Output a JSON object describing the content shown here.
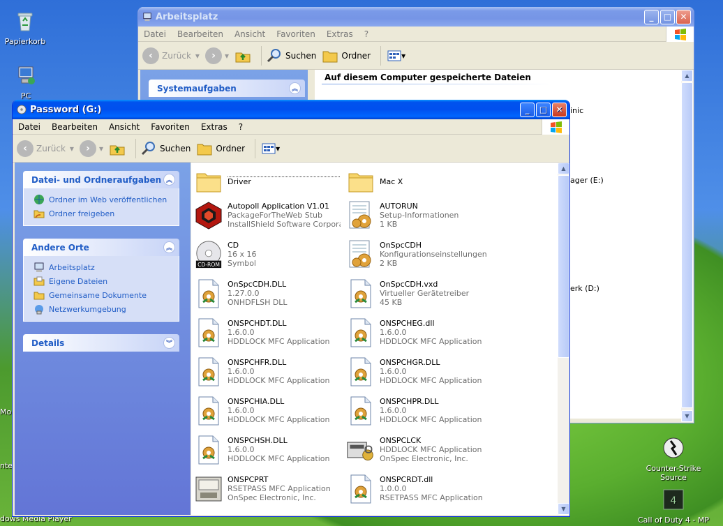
{
  "desktop": {
    "icons": [
      {
        "label": "Papierkorb",
        "icon": "recycle-bin-icon"
      },
      {
        "label": "PC",
        "icon": "my-computer-icon"
      },
      {
        "label": "Counter-Strike Source",
        "icon": "counter-strike-icon"
      },
      {
        "label": "Call of Duty 4 - MP",
        "icon": "call-of-duty-icon"
      }
    ],
    "partial_labels": [
      "Mo",
      "nter",
      "dows Media Player"
    ]
  },
  "bg_window": {
    "title": "Arbeitsplatz",
    "menu": [
      "Datei",
      "Bearbeiten",
      "Ansicht",
      "Favoriten",
      "Extras",
      "?"
    ],
    "toolbar": {
      "back": "Zurück",
      "search": "Suchen",
      "folders": "Ordner"
    },
    "left_panel_title": "Systemaufgaben",
    "section_header": "Auf diesem Computer gespeicherte Dateien",
    "partial_items": [
      "inic",
      "ager (E:)",
      "erk (D:)"
    ]
  },
  "window": {
    "title": "Password (G:)",
    "menu": [
      "Datei",
      "Bearbeiten",
      "Ansicht",
      "Favoriten",
      "Extras",
      "?"
    ],
    "toolbar": {
      "back": "Zurück",
      "search": "Suchen",
      "folders": "Ordner"
    },
    "tasks": {
      "title": "Datei- und Ordneraufgaben",
      "links": [
        {
          "label": "Ordner im Web veröffentlichen",
          "icon": "publish-web-icon"
        },
        {
          "label": "Ordner freigeben",
          "icon": "share-folder-icon"
        }
      ]
    },
    "places": {
      "title": "Andere Orte",
      "links": [
        {
          "label": "Arbeitsplatz",
          "icon": "my-computer-icon"
        },
        {
          "label": "Eigene Dateien",
          "icon": "my-documents-icon"
        },
        {
          "label": "Gemeinsame Dokumente",
          "icon": "shared-documents-icon"
        },
        {
          "label": "Netzwerkumgebung",
          "icon": "network-icon"
        }
      ]
    },
    "details": {
      "title": "Details"
    },
    "files": [
      {
        "name": "Driver",
        "line2": "",
        "line3": "",
        "icon": "folder-icon"
      },
      {
        "name": "Mac X",
        "line2": "",
        "line3": "",
        "icon": "folder-icon"
      },
      {
        "name": "Autopoll Application V1.01",
        "line2": "PackageForTheWeb Stub",
        "line3": "InstallShield Software Corpora...",
        "icon": "installshield-icon"
      },
      {
        "name": "AUTORUN",
        "line2": "Setup-Informationen",
        "line3": "1 KB",
        "icon": "settings-file-icon"
      },
      {
        "name": "CD",
        "line2": "16 x 16",
        "line3": "Symbol",
        "icon": "cdrom-icon"
      },
      {
        "name": "OnSpcCDH",
        "line2": "Konfigurationseinstellungen",
        "line3": "2 KB",
        "icon": "settings-file-icon"
      },
      {
        "name": "OnSpcCDH.DLL",
        "line2": "1.27.0.0",
        "line3": "ONHDFLSH DLL",
        "icon": "dll-icon"
      },
      {
        "name": "OnSpcCDH.vxd",
        "line2": "Virtueller Gerätetreiber",
        "line3": "45 KB",
        "icon": "dll-icon"
      },
      {
        "name": "ONSPCHDT.DLL",
        "line2": "1.6.0.0",
        "line3": "HDDLOCK MFC Application",
        "icon": "dll-icon"
      },
      {
        "name": "ONSPCHEG.dll",
        "line2": "1.6.0.0",
        "line3": "HDDLOCK MFC Application",
        "icon": "dll-icon"
      },
      {
        "name": "ONSPCHFR.DLL",
        "line2": "1.6.0.0",
        "line3": "HDDLOCK MFC Application",
        "icon": "dll-icon"
      },
      {
        "name": "ONSPCHGR.DLL",
        "line2": "1.6.0.0",
        "line3": "HDDLOCK MFC Application",
        "icon": "dll-icon"
      },
      {
        "name": "ONSPCHIA.DLL",
        "line2": "1.6.0.0",
        "line3": "HDDLOCK MFC Application",
        "icon": "dll-icon"
      },
      {
        "name": "ONSPCHPR.DLL",
        "line2": "1.6.0.0",
        "line3": "HDDLOCK MFC Application",
        "icon": "dll-icon"
      },
      {
        "name": "ONSPCHSH.DLL",
        "line2": "1.6.0.0",
        "line3": "HDDLOCK MFC Application",
        "icon": "dll-icon"
      },
      {
        "name": "ONSPCLCK",
        "line2": "HDDLOCK MFC Application",
        "line3": "OnSpec Electronic, Inc.",
        "icon": "lock-app-icon"
      },
      {
        "name": "ONSPCPRT",
        "line2": "RSETPASS MFC Application",
        "line3": "OnSpec Electronic, Inc.",
        "icon": "drive-app-icon"
      },
      {
        "name": "ONSPCRDT.dll",
        "line2": "1.0.0.0",
        "line3": "RSETPASS MFC Application",
        "icon": "dll-icon"
      }
    ]
  }
}
